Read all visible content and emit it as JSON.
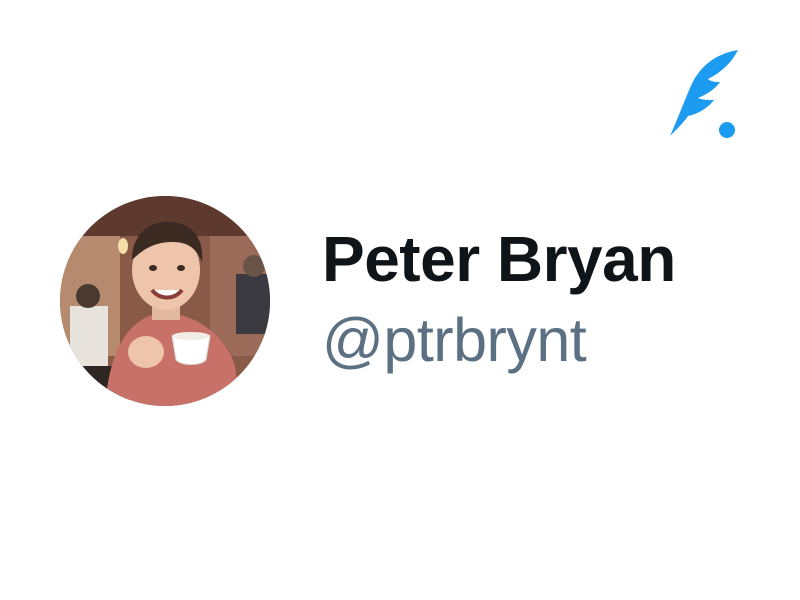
{
  "profile": {
    "display_name": "Peter Bryan",
    "handle": "@ptrbrynt"
  },
  "brand": {
    "logo_icon": "quill-feather-icon",
    "accent_color": "#1d9bf0"
  },
  "colors": {
    "name_text": "#0f1419",
    "handle_text": "#5b7083",
    "background": "#ffffff"
  }
}
